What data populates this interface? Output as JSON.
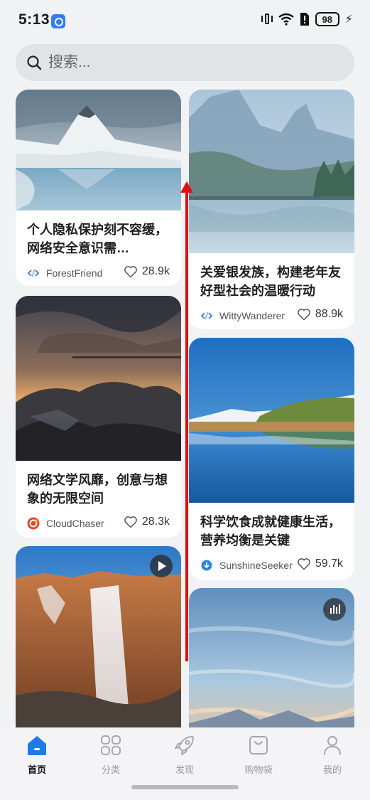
{
  "status_bar": {
    "time": "5:13",
    "battery": "98"
  },
  "search": {
    "placeholder": "搜索..."
  },
  "feed": {
    "cards": [
      {
        "title": "个人隐私保护刻不容缓，网络安全意识需…",
        "author": "ForestFriend",
        "likes": "28.9k",
        "author_icon": "code-icon"
      },
      {
        "title": "关爱银发族，构建老年友好型社会的温暖行动",
        "author": "WittyWanderer",
        "likes": "88.9k",
        "author_icon": "code-icon"
      },
      {
        "title": "网络文学风靡，创意与想象的无限空间",
        "author": "CloudChaser",
        "likes": "28.3k",
        "author_icon": "red-circle-logo-icon"
      },
      {
        "title": "科学饮食成就健康生活，营养均衡是关键",
        "author": "SunshineSeeker",
        "likes": "59.7k",
        "author_icon": "blue-download-icon"
      },
      {
        "title": "",
        "author": "",
        "likes": "",
        "badge": "play-icon"
      },
      {
        "title": "",
        "author": "",
        "likes": "",
        "badge": "audio-icon"
      }
    ]
  },
  "bottom_nav": {
    "items": [
      {
        "label": "首页",
        "icon": "home-icon",
        "active": true
      },
      {
        "label": "分类",
        "icon": "grid-icon",
        "active": false
      },
      {
        "label": "发现",
        "icon": "rocket-icon",
        "active": false
      },
      {
        "label": "购物袋",
        "icon": "shopping-bag-icon",
        "active": false
      },
      {
        "label": "我的",
        "icon": "person-icon",
        "active": false
      }
    ]
  },
  "colors": {
    "accent": "#1f7ae8",
    "swipe_arrow": "#e01010",
    "background": "#f1f2f4"
  }
}
